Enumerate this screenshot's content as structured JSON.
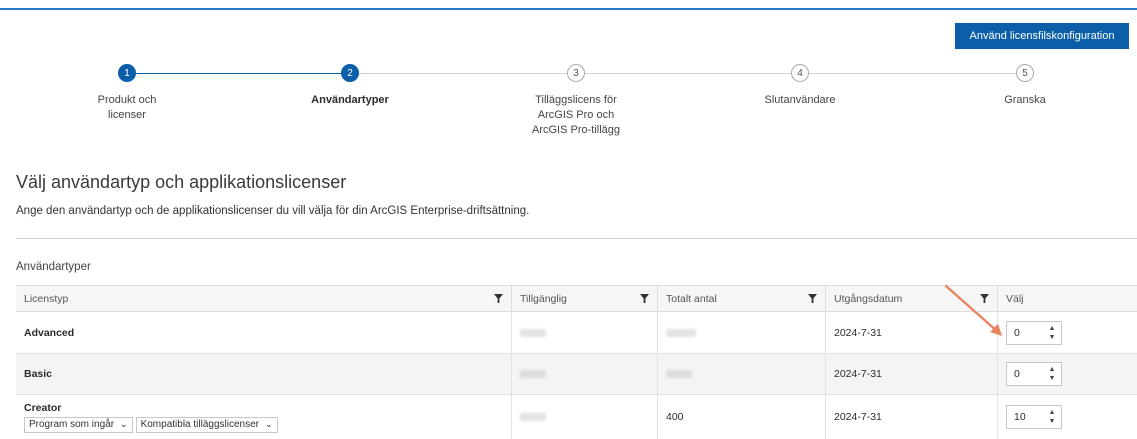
{
  "header": {
    "config_button": "Använd licensfilskonfiguration"
  },
  "steps": [
    {
      "number": "1",
      "label_lines": [
        "Produkt och",
        "licenser"
      ],
      "state": "done"
    },
    {
      "number": "2",
      "label_lines": [
        "Användartyper"
      ],
      "state": "active"
    },
    {
      "number": "3",
      "label_lines": [
        "Tilläggslicens för",
        "ArcGIS Pro och",
        "ArcGIS Pro-tillägg"
      ],
      "state": "todo"
    },
    {
      "number": "4",
      "label_lines": [
        "Slutanvändare"
      ],
      "state": "todo"
    },
    {
      "number": "5",
      "label_lines": [
        "Granska"
      ],
      "state": "todo"
    }
  ],
  "page": {
    "title": "Välj användartyp och applikationslicenser",
    "description": "Ange den användartyp och de applikationslicenser du vill välja för din ArcGIS Enterprise-driftsättning.",
    "section_title": "Användartyper"
  },
  "table": {
    "columns": [
      "Licenstyp",
      "Tillgänglig",
      "Totalt antal",
      "Utgångsdatum",
      "Välj"
    ],
    "rows": [
      {
        "name": "Advanced",
        "available": "",
        "total": "",
        "expiry": "2024-7-31",
        "select": "0"
      },
      {
        "name": "Basic",
        "available": "",
        "total": "",
        "expiry": "2024-7-31",
        "select": "0"
      },
      {
        "name": "Creator",
        "available": "",
        "total": "400",
        "expiry": "2024-7-31",
        "select": "10",
        "dropdowns": [
          "Program som ingår",
          "Kompatibla tilläggslicenser"
        ]
      }
    ]
  },
  "colors": {
    "accent": "#0b5fa8",
    "arrow": "#e8825a"
  },
  "icons": [
    "filter-icon",
    "spin-up-icon",
    "spin-down-icon",
    "chevron-down-icon",
    "annotation-arrow"
  ]
}
